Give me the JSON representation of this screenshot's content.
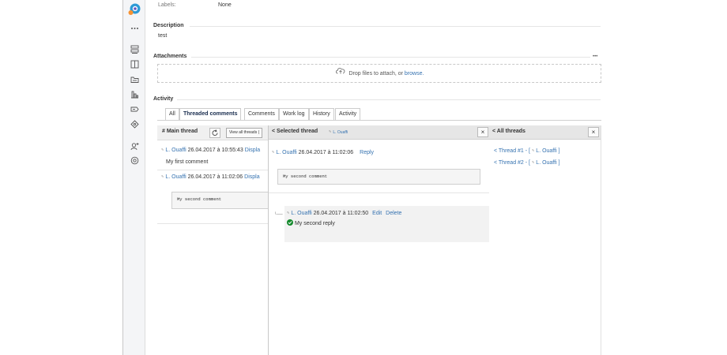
{
  "fields": {
    "labels": {
      "label": "Labels:",
      "value": "None"
    }
  },
  "description": {
    "title": "Description",
    "text": "test"
  },
  "attachments": {
    "title": "Attachments",
    "more": "•••",
    "drop_text": "Drop files to attach, or ",
    "browse": "browse."
  },
  "activity": {
    "title": "Activity",
    "tabs": [
      "All",
      "Threaded comments",
      "Comments",
      "Work log",
      "History",
      "Activity"
    ],
    "active_tab": "Threaded comments"
  },
  "main_thread": {
    "title": "# Main thread",
    "view_all": "View all threads (",
    "comments": [
      {
        "avatar": "✎",
        "author": "L. Ouaffi",
        "date": "26.04.2017 à 10:55:43",
        "action": "Displa",
        "text": "My first comment"
      },
      {
        "avatar": "✎",
        "author": "L. Ouaffi",
        "date": "26.04.2017 à 11:02:06",
        "action": "Displa",
        "code": "My second comment"
      }
    ]
  },
  "selected_thread": {
    "title": "< Selected thread",
    "header_author": "L. Ouaffi",
    "avatar": "✎",
    "close": "×",
    "comment": {
      "author": "L. Ouaffi",
      "date": "26.04.2017 à 11:02:06",
      "reply": "Reply",
      "code": "My second comment"
    },
    "reply": {
      "author": "L. Ouaffi",
      "date": "26.04.2017 à 11:02:50",
      "edit": "Edit",
      "delete": "Delete",
      "text": "My second reply",
      "connector": "└──"
    }
  },
  "all_threads": {
    "title": "< All threads",
    "close": "×",
    "items": [
      {
        "label": "< Thread #1 - [",
        "author": "L. Ouaffi",
        "end": "]"
      },
      {
        "label": "< Thread #2 - [",
        "author": "L. Ouaffi",
        "end": "]"
      }
    ]
  },
  "colors": {
    "link": "#3572b0",
    "accent_check": "#14892c",
    "header_bg": "#e6e6e6"
  },
  "icons": [
    "project-avatar-icon",
    "more-icon",
    "backlog-icon",
    "board-icon",
    "releases-icon",
    "reports-icon",
    "issues-icon",
    "components-icon",
    "add-user-icon",
    "settings-icon",
    "cloud-upload-icon",
    "refresh-icon",
    "check-icon"
  ]
}
